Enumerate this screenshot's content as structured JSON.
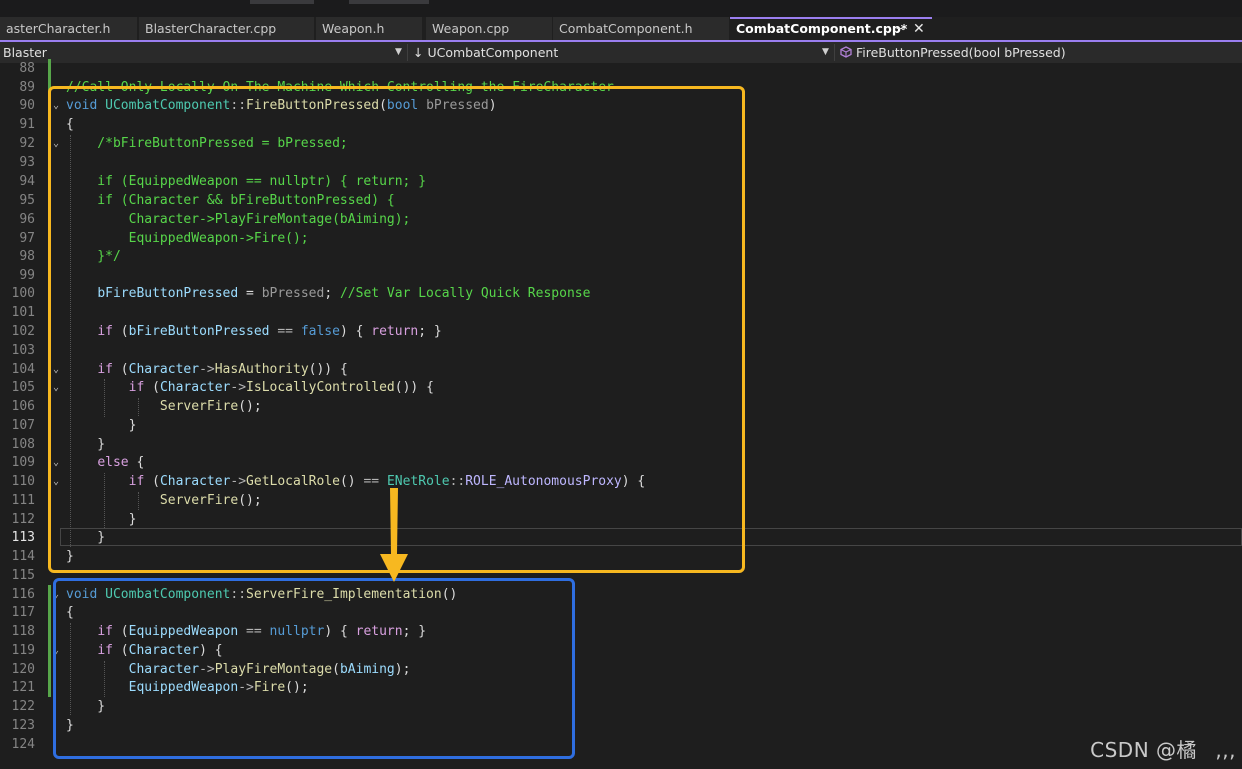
{
  "tabs": [
    {
      "label": "asterCharacter.h"
    },
    {
      "label": "BlasterCharacter.cpp"
    },
    {
      "label": "Weapon.h"
    },
    {
      "label": "Weapon.cpp"
    },
    {
      "label": "CombatComponent.h"
    },
    {
      "label": "CombatComponent.cpp*",
      "active": true
    }
  ],
  "tab_icons": {
    "pin": "pin-icon",
    "close": "close-icon"
  },
  "navbar": {
    "project": "Blaster",
    "scope": "↓ UCombatComponent",
    "member": "FireButtonPressed(bool bPressed)",
    "member_icon": "method-cube-icon"
  },
  "editor": {
    "current_line": 113,
    "lines": [
      {
        "n": 88,
        "text": ""
      },
      {
        "n": 89,
        "text": "//Call Only Locally On The Machine Which Controlling the FireCharacter"
      },
      {
        "n": 90,
        "text": "void UCombatComponent::FireButtonPressed(bool bPressed)"
      },
      {
        "n": 91,
        "text": "{"
      },
      {
        "n": 92,
        "text": "    /*bFireButtonPressed = bPressed;"
      },
      {
        "n": 93,
        "text": ""
      },
      {
        "n": 94,
        "text": "    if (EquippedWeapon == nullptr) { return; }"
      },
      {
        "n": 95,
        "text": "    if (Character && bFireButtonPressed) {"
      },
      {
        "n": 96,
        "text": "        Character->PlayFireMontage(bAiming);"
      },
      {
        "n": 97,
        "text": "        EquippedWeapon->Fire();"
      },
      {
        "n": 98,
        "text": "    }*/"
      },
      {
        "n": 99,
        "text": ""
      },
      {
        "n": 100,
        "text": "    bFireButtonPressed = bPressed; //Set Var Locally Quick Response"
      },
      {
        "n": 101,
        "text": ""
      },
      {
        "n": 102,
        "text": "    if (bFireButtonPressed == false) { return; }"
      },
      {
        "n": 103,
        "text": ""
      },
      {
        "n": 104,
        "text": "    if (Character->HasAuthority()) {"
      },
      {
        "n": 105,
        "text": "        if (Character->IsLocallyControlled()) {"
      },
      {
        "n": 106,
        "text": "            ServerFire();"
      },
      {
        "n": 107,
        "text": "        }"
      },
      {
        "n": 108,
        "text": "    }"
      },
      {
        "n": 109,
        "text": "    else {"
      },
      {
        "n": 110,
        "text": "        if (Character->GetLocalRole() == ENetRole::ROLE_AutonomousProxy) {"
      },
      {
        "n": 111,
        "text": "            ServerFire();"
      },
      {
        "n": 112,
        "text": "        }"
      },
      {
        "n": 113,
        "text": "    }"
      },
      {
        "n": 114,
        "text": "}"
      },
      {
        "n": 115,
        "text": ""
      },
      {
        "n": 116,
        "text": "void UCombatComponent::ServerFire_Implementation()"
      },
      {
        "n": 117,
        "text": "{"
      },
      {
        "n": 118,
        "text": "    if (EquippedWeapon == nullptr) { return; }"
      },
      {
        "n": 119,
        "text": "    if (Character) {"
      },
      {
        "n": 120,
        "text": "        Character->PlayFireMontage(bAiming);"
      },
      {
        "n": 121,
        "text": "        EquippedWeapon->Fire();"
      },
      {
        "n": 122,
        "text": "    }"
      },
      {
        "n": 123,
        "text": "}"
      },
      {
        "n": 124,
        "text": ""
      }
    ]
  },
  "annotations": {
    "highlight_color": "#f7b820",
    "target_color": "#2f6ee0",
    "arrow_icon": "down-arrow-icon"
  },
  "watermark": "CSDN @橘ㅤ,,,"
}
